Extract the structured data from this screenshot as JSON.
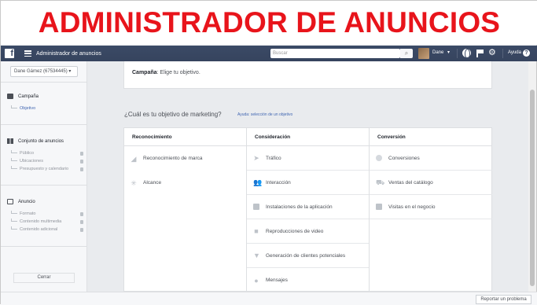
{
  "banner": {
    "text": "ADMINISTRADOR DE ANUNCIOS"
  },
  "topbar": {
    "app_title": "Administrador de anuncios",
    "search_placeholder": "Buscar",
    "user_name": "Dane",
    "help_label": "Ayuda"
  },
  "sidebar": {
    "account": "Dane Gámez (67534445)",
    "sections": [
      {
        "title": "Campaña",
        "items": [
          {
            "label": "Objetivo",
            "active": true
          }
        ]
      },
      {
        "title": "Conjunto de anuncios",
        "items": [
          {
            "label": "Público"
          },
          {
            "label": "Ubicaciones"
          },
          {
            "label": "Presupuesto y calendario"
          }
        ]
      },
      {
        "title": "Anuncio",
        "items": [
          {
            "label": "Formato"
          },
          {
            "label": "Contenido multimedia"
          },
          {
            "label": "Contenido adicional"
          }
        ]
      }
    ],
    "close_label": "Cerrar"
  },
  "main": {
    "campaign_label": "Campaña",
    "campaign_value": ": Elige tu objetivo.",
    "question": "¿Cuál es tu objetivo de marketing?",
    "help_link": "Ayuda: selección de un objetivo",
    "columns": [
      {
        "title": "Reconocimiento",
        "items": [
          "Reconocimiento de marca",
          "Alcance"
        ]
      },
      {
        "title": "Consideración",
        "items": [
          "Tráfico",
          "Interacción",
          "Instalaciones de la aplicación",
          "Reproducciones de video",
          "Generación de clientes potenciales",
          "Mensajes"
        ]
      },
      {
        "title": "Conversión",
        "items": [
          "Conversiones",
          "Ventas del catálogo",
          "Visitas en el negocio"
        ]
      }
    ]
  },
  "footer": {
    "report_label": "Reportar un problema"
  }
}
